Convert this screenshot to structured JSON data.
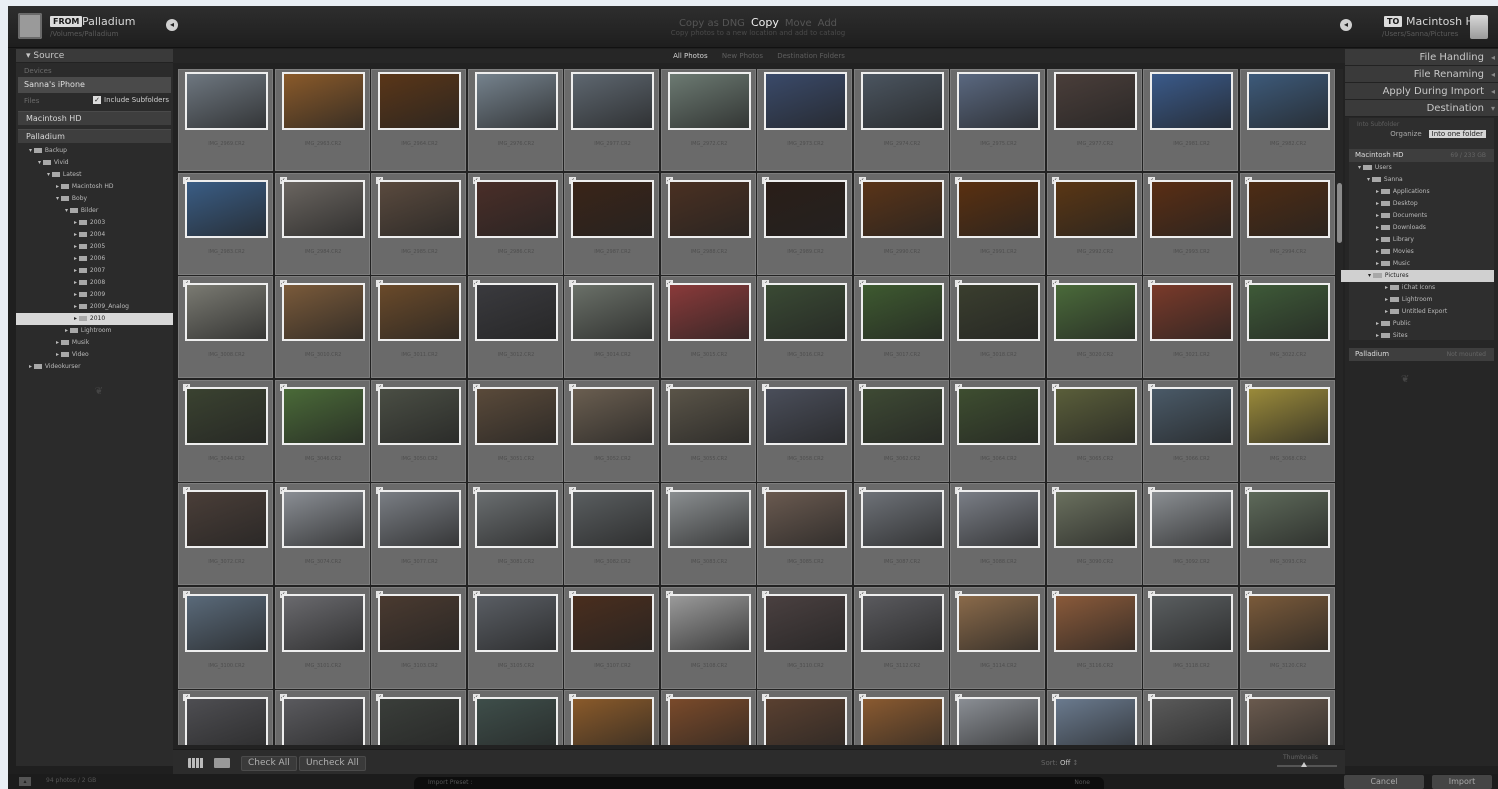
{
  "topbar": {
    "from_badge": "FROM",
    "source_name": "Palladium",
    "source_sub": "/Volumes/Palladium",
    "modes": [
      "Copy as DNG",
      "Copy",
      "Move",
      "Add"
    ],
    "active_mode": "Copy",
    "modes_sub": "Copy photos to a new location and add to catalog",
    "to_badge": "TO",
    "dest_name": "Macintosh HD",
    "dest_sub": "/Users/Sanna/Pictures"
  },
  "left": {
    "header": "Source",
    "devices_label": "Devices",
    "device": "Sanna's iPhone",
    "files_label": "Files",
    "include_subfolders": "Include Subfolders",
    "volumes": [
      "Macintosh HD",
      "Palladium"
    ],
    "tree": [
      {
        "label": "Backup",
        "indent": 1,
        "open": true
      },
      {
        "label": "Vivid",
        "indent": 2,
        "open": true
      },
      {
        "label": "Latest",
        "indent": 3,
        "open": true
      },
      {
        "label": "Macintosh HD",
        "indent": 4,
        "open": false
      },
      {
        "label": "Boby",
        "indent": 4,
        "open": true
      },
      {
        "label": "Bilder",
        "indent": 5,
        "open": true
      },
      {
        "label": "2003",
        "indent": 6,
        "open": false
      },
      {
        "label": "2004",
        "indent": 6,
        "open": false
      },
      {
        "label": "2005",
        "indent": 6,
        "open": false
      },
      {
        "label": "2006",
        "indent": 6,
        "open": false
      },
      {
        "label": "2007",
        "indent": 6,
        "open": false
      },
      {
        "label": "2008",
        "indent": 6,
        "open": false
      },
      {
        "label": "2009",
        "indent": 6,
        "open": false
      },
      {
        "label": "2009_Analog",
        "indent": 6,
        "open": false
      },
      {
        "label": "2010",
        "indent": 6,
        "open": false,
        "selected": true
      },
      {
        "label": "Lightroom",
        "indent": 5,
        "open": false
      },
      {
        "label": "Musik",
        "indent": 4,
        "open": false
      },
      {
        "label": "Video",
        "indent": 4,
        "open": false
      },
      {
        "label": "Videokurser",
        "indent": 1,
        "open": false
      }
    ]
  },
  "center": {
    "filters": [
      "All Photos",
      "New Photos",
      "Destination Folders"
    ],
    "active_filter": "All Photos",
    "check_all": "Check All",
    "uncheck_all": "Uncheck All",
    "sort_label": "Sort:",
    "sort_value": "Off",
    "thumbnails_label": "Thumbnails",
    "photos": [
      {
        "name": "IMG_2969.CR2",
        "color": "#6e7780"
      },
      {
        "name": "IMG_2963.CR2",
        "color": "#8a5a2a"
      },
      {
        "name": "IMG_2964.CR2",
        "color": "#5a3618"
      },
      {
        "name": "IMG_2976.CR2",
        "color": "#75828d"
      },
      {
        "name": "IMG_2977.CR2",
        "color": "#5e6770"
      },
      {
        "name": "IMG_2972.CR2",
        "color": "#6c7a72"
      },
      {
        "name": "IMG_2973.CR2",
        "color": "#3a4a6a"
      },
      {
        "name": "IMG_2974.CR2",
        "color": "#4b5560"
      },
      {
        "name": "IMG_2975.CR2",
        "color": "#5a6880"
      },
      {
        "name": "IMG_2977.CR2",
        "color": "#4a3e3a"
      },
      {
        "name": "IMG_2981.CR2",
        "color": "#3a5a8a"
      },
      {
        "name": "IMG_2982.CR2",
        "color": "#3d5a7a"
      },
      {
        "name": "IMG_2983.CR2",
        "color": "#3a5d85"
      },
      {
        "name": "IMG_2984.CR2",
        "color": "#6a6560"
      },
      {
        "name": "IMG_2985.CR2",
        "color": "#5a4a3e"
      },
      {
        "name": "IMG_2986.CR2",
        "color": "#4a2e28"
      },
      {
        "name": "IMG_2987.CR2",
        "color": "#3a2418"
      },
      {
        "name": "IMG_2988.CR2",
        "color": "#4a3022"
      },
      {
        "name": "IMG_2989.CR2",
        "color": "#2a1e18"
      },
      {
        "name": "IMG_2990.CR2",
        "color": "#5a3418"
      },
      {
        "name": "IMG_2991.CR2",
        "color": "#5a3010"
      },
      {
        "name": "IMG_2992.CR2",
        "color": "#5a3614"
      },
      {
        "name": "IMG_2993.CR2",
        "color": "#5a2e14"
      },
      {
        "name": "IMG_2994.CR2",
        "color": "#4e2c14"
      },
      {
        "name": "IMG_3008.CR2",
        "color": "#7a7a72"
      },
      {
        "name": "IMG_3010.CR2",
        "color": "#7a5a3a"
      },
      {
        "name": "IMG_3011.CR2",
        "color": "#6a4a2a"
      },
      {
        "name": "IMG_3012.CR2",
        "color": "#3a3a3e"
      },
      {
        "name": "IMG_3014.CR2",
        "color": "#6a7068"
      },
      {
        "name": "IMG_3015.CR2",
        "color": "#8a3a3a"
      },
      {
        "name": "IMG_3016.CR2",
        "color": "#3a4a34"
      },
      {
        "name": "IMG_3017.CR2",
        "color": "#3e5a30"
      },
      {
        "name": "IMG_3018.CR2",
        "color": "#3a3e2e"
      },
      {
        "name": "IMG_3020.CR2",
        "color": "#4a6a3a"
      },
      {
        "name": "IMG_3021.CR2",
        "color": "#7a3a2a"
      },
      {
        "name": "IMG_3022.CR2",
        "color": "#3e5a38"
      },
      {
        "name": "IMG_3044.CR2",
        "color": "#3a4230"
      },
      {
        "name": "IMG_3046.CR2",
        "color": "#4a6a38"
      },
      {
        "name": "IMG_3050.CR2",
        "color": "#4a4e44"
      },
      {
        "name": "IMG_3051.CR2",
        "color": "#5a4a3a"
      },
      {
        "name": "IMG_3052.CR2",
        "color": "#6a5e50"
      },
      {
        "name": "IMG_3055.CR2",
        "color": "#5a5448"
      },
      {
        "name": "IMG_3058.CR2",
        "color": "#4a4e5a"
      },
      {
        "name": "IMG_3062.CR2",
        "color": "#3e4a34"
      },
      {
        "name": "IMG_3064.CR2",
        "color": "#3e4e30"
      },
      {
        "name": "IMG_3065.CR2",
        "color": "#5a5e3a"
      },
      {
        "name": "IMG_3066.CR2",
        "color": "#4a5a68"
      },
      {
        "name": "IMG_3068.CR2",
        "color": "#9a8a3a"
      },
      {
        "name": "IMG_3072.CR2",
        "color": "#4a3e38"
      },
      {
        "name": "IMG_3074.CR2",
        "color": "#8a8e94"
      },
      {
        "name": "IMG_3077.CR2",
        "color": "#7a7e84"
      },
      {
        "name": "IMG_3081.CR2",
        "color": "#6a6e70"
      },
      {
        "name": "IMG_3082.CR2",
        "color": "#5a5e60"
      },
      {
        "name": "IMG_3083.CR2",
        "color": "#8a8e90"
      },
      {
        "name": "IMG_3085.CR2",
        "color": "#6a5a50"
      },
      {
        "name": "IMG_3087.CR2",
        "color": "#6e7278"
      },
      {
        "name": "IMG_3088.CR2",
        "color": "#7a7e86"
      },
      {
        "name": "IMG_3090.CR2",
        "color": "#6a705e"
      },
      {
        "name": "IMG_3092.CR2",
        "color": "#8a8e92"
      },
      {
        "name": "IMG_3093.CR2",
        "color": "#5e6a5a"
      },
      {
        "name": "IMG_3100.CR2",
        "color": "#5a6a7a"
      },
      {
        "name": "IMG_3101.CR2",
        "color": "#6a6a6e"
      },
      {
        "name": "IMG_3103.CR2",
        "color": "#4a3a30"
      },
      {
        "name": "IMG_3105.CR2",
        "color": "#5a5e64"
      },
      {
        "name": "IMG_3107.CR2",
        "color": "#4a2e1e"
      },
      {
        "name": "IMG_3108.CR2",
        "color": "#9a9a9a"
      },
      {
        "name": "IMG_3110.CR2",
        "color": "#4a4040"
      },
      {
        "name": "IMG_3112.CR2",
        "color": "#5a5a5e"
      },
      {
        "name": "IMG_3114.CR2",
        "color": "#8a6a4a"
      },
      {
        "name": "IMG_3116.CR2",
        "color": "#8a5a3a"
      },
      {
        "name": "IMG_3118.CR2",
        "color": "#5a5e60"
      },
      {
        "name": "IMG_3120.CR2",
        "color": "#7a5a3a"
      },
      {
        "name": "IMG_3122.CR2",
        "color": "#4e4e52"
      },
      {
        "name": "IMG_3124.CR2",
        "color": "#5a5a5e"
      },
      {
        "name": "IMG_3126.CR2",
        "color": "#3a3e3a"
      },
      {
        "name": "IMG_3128.CR2",
        "color": "#3e4e4a"
      },
      {
        "name": "IMG_3130.CR2",
        "color": "#8a5a2a"
      },
      {
        "name": "IMG_3132.CR2",
        "color": "#7a4a2a"
      },
      {
        "name": "IMG_3134.CR2",
        "color": "#5a4030"
      },
      {
        "name": "IMG_3136.CR2",
        "color": "#8a5a30"
      },
      {
        "name": "IMG_3138.CR2",
        "color": "#8a8e94"
      },
      {
        "name": "IMG_3140.CR2",
        "color": "#6a7a8e"
      },
      {
        "name": "IMG_3142.CR2",
        "color": "#5a5a5a"
      },
      {
        "name": "IMG_3144.CR2",
        "color": "#6a5a4e"
      }
    ]
  },
  "right": {
    "file_handling": "File Handling",
    "file_renaming": "File Renaming",
    "apply_during_import": "Apply During Import",
    "destination": "Destination",
    "into_subfolder": "Into Subfolder",
    "organize_label": "Organize",
    "organize_value": "Into one folder",
    "volume": "Macintosh HD",
    "volume_space": "69 / 233 GB",
    "volume2": "Palladium",
    "volume2_space": "Not mounted",
    "tree": [
      {
        "label": "Users",
        "indent": 1,
        "open": true
      },
      {
        "label": "Sanna",
        "indent": 2,
        "open": true
      },
      {
        "label": "Applications",
        "indent": 3,
        "open": false
      },
      {
        "label": "Desktop",
        "indent": 3,
        "open": false
      },
      {
        "label": "Documents",
        "indent": 3,
        "open": false
      },
      {
        "label": "Downloads",
        "indent": 3,
        "open": false
      },
      {
        "label": "Library",
        "indent": 3,
        "open": false
      },
      {
        "label": "Movies",
        "indent": 3,
        "open": false
      },
      {
        "label": "Music",
        "indent": 3,
        "open": false
      },
      {
        "label": "Pictures",
        "indent": 3,
        "open": true,
        "selected": true
      },
      {
        "label": "iChat Icons",
        "indent": 4,
        "open": false
      },
      {
        "label": "Lightroom",
        "indent": 4,
        "open": false
      },
      {
        "label": "Untitled Export",
        "indent": 4,
        "open": false
      },
      {
        "label": "Public",
        "indent": 3,
        "open": false
      },
      {
        "label": "Sites",
        "indent": 3,
        "open": false
      }
    ]
  },
  "bottom": {
    "summary": "94 photos / 2 GB",
    "preset_label": "Import Preset :",
    "preset_value": "None",
    "cancel": "Cancel",
    "import": "Import"
  }
}
